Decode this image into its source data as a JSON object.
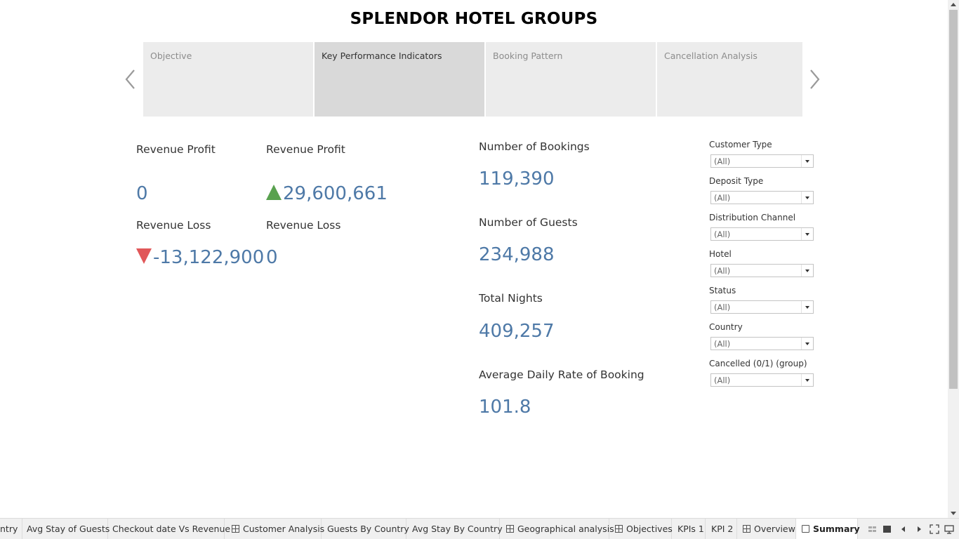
{
  "title": "SPLENDOR HOTEL GROUPS",
  "story_points": [
    {
      "label": "Objective",
      "active": false
    },
    {
      "label": "Key Performance Indicators",
      "active": true
    },
    {
      "label": "Booking Pattern",
      "active": false
    },
    {
      "label": "Cancellation Analysis",
      "active": false
    }
  ],
  "revenue": {
    "profit_label_1": "Revenue Profit",
    "profit_value_1": "0",
    "profit_label_2": "Revenue Profit",
    "profit_value_2": "29,600,661",
    "loss_label_1": "Revenue Loss",
    "loss_value_1": "-13,122,900",
    "loss_label_2": "Revenue Loss",
    "loss_value_2": "0",
    "up_color": "#59a14f",
    "down_color": "#e15759"
  },
  "kpis": [
    {
      "label": "Number of Bookings",
      "value": "119,390"
    },
    {
      "label": "Number of Guests",
      "value": "234,988"
    },
    {
      "label": "Total Nights",
      "value": "409,257"
    },
    {
      "label": "Average Daily Rate of Booking",
      "value": "101.8"
    }
  ],
  "value_color": "#4e79a7",
  "filters": [
    {
      "label": "Customer Type",
      "value": "(All)"
    },
    {
      "label": "Deposit Type",
      "value": "(All)"
    },
    {
      "label": "Distribution Channel",
      "value": "(All)"
    },
    {
      "label": "Hotel",
      "value": "(All)"
    },
    {
      "label": "Status",
      "value": "(All)"
    },
    {
      "label": "Country",
      "value": "(All)"
    },
    {
      "label": "Cancelled (0/1) (group)",
      "value": "(All)"
    }
  ],
  "tabs": [
    {
      "label": "ntry",
      "icon": "none"
    },
    {
      "label": "Avg Stay of Guests",
      "icon": "none"
    },
    {
      "label": "Checkout date Vs Revenue",
      "icon": "none"
    },
    {
      "label": "Customer Analysis",
      "icon": "dashboard-icon"
    },
    {
      "label": "Guests By Country",
      "icon": "none"
    },
    {
      "label": "Avg Stay By Country",
      "icon": "none"
    },
    {
      "label": "Geographical analysis",
      "icon": "dashboard-icon"
    },
    {
      "label": "Objectives",
      "icon": "dashboard-icon"
    },
    {
      "label": "KPIs 1",
      "icon": "none"
    },
    {
      "label": "KPI 2",
      "icon": "none"
    },
    {
      "label": "Overview",
      "icon": "dashboard-icon"
    },
    {
      "label": "Summary",
      "icon": "story-icon",
      "active": true
    }
  ]
}
